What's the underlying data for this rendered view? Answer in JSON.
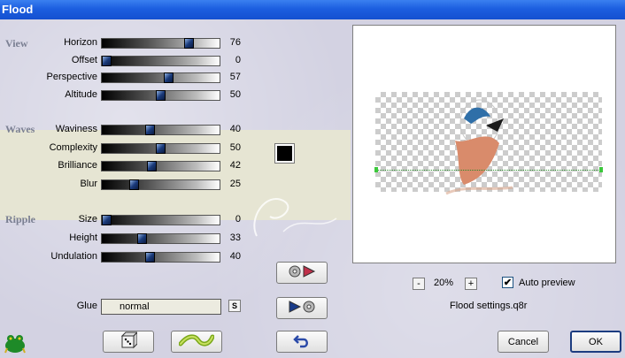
{
  "window": {
    "title": "Flood"
  },
  "sections": {
    "view": "View",
    "waves": "Waves",
    "ripple": "Ripple"
  },
  "sliders": [
    {
      "label": "Horizon",
      "value": "76",
      "level": 0.76
    },
    {
      "label": "Offset",
      "value": "0",
      "level": 0.0
    },
    {
      "label": "Perspective",
      "value": "57",
      "level": 0.57
    },
    {
      "label": "Altitude",
      "value": "50",
      "level": 0.5
    },
    {
      "label": "Waviness",
      "value": "40",
      "level": 0.4
    },
    {
      "label": "Complexity",
      "value": "50",
      "level": 0.5
    },
    {
      "label": "Brilliance",
      "value": "42",
      "level": 0.42
    },
    {
      "label": "Blur",
      "value": "25",
      "level": 0.25
    },
    {
      "label": "Size",
      "value": "0",
      "level": 0.0
    },
    {
      "label": "Height",
      "value": "33",
      "level": 0.33
    },
    {
      "label": "Undulation",
      "value": "40",
      "level": 0.4
    }
  ],
  "glue": {
    "label": "Glue",
    "value": "normal",
    "s_button": "S"
  },
  "zoom": {
    "minus": "-",
    "value": "20%",
    "plus": "+"
  },
  "auto_preview": {
    "label": "Auto preview",
    "checked": true,
    "mark": "✔"
  },
  "settings_file": "Flood settings.q8r",
  "buttons": {
    "cancel": "Cancel",
    "ok": "OK"
  },
  "watermark": "Pinuccia",
  "colors": {
    "title_bar": "#1c5ee0",
    "swatch": "#000000",
    "waves_band": "#e6e5d3"
  },
  "icons": [
    "frog-icon",
    "dice-icon",
    "wave-icon",
    "undo-icon",
    "load-preset-icon",
    "save-preset-icon"
  ]
}
